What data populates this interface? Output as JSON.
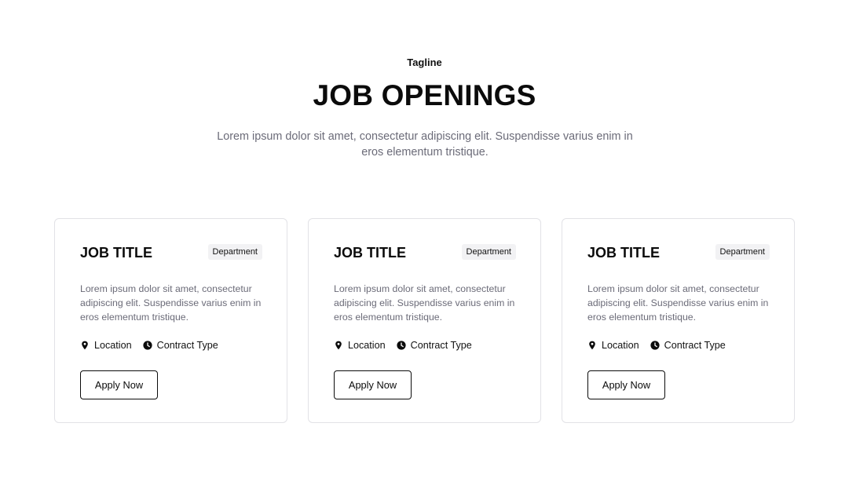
{
  "header": {
    "tagline": "Tagline",
    "title": "JOB OPENINGS",
    "description": "Lorem ipsum dolor sit amet, consectetur adipiscing elit. Suspendisse varius enim in eros elementum tristique."
  },
  "jobs": [
    {
      "title": "JOB TITLE",
      "department": "Department",
      "description": "Lorem ipsum dolor sit amet, consectetur adipiscing elit. Suspendisse varius enim in eros elementum tristique.",
      "location": "Location",
      "contract_type": "Contract Type",
      "location_icon": "map-pin-icon",
      "contract_icon": "clock-icon",
      "apply_label": "Apply Now"
    },
    {
      "title": "JOB TITLE",
      "department": "Department",
      "description": "Lorem ipsum dolor sit amet, consectetur adipiscing elit. Suspendisse varius enim in eros elementum tristique.",
      "location": "Location",
      "contract_type": "Contract Type",
      "location_icon": "map-pin-icon",
      "contract_icon": "clock-icon",
      "apply_label": "Apply Now"
    },
    {
      "title": "JOB TITLE",
      "department": "Department",
      "description": "Lorem ipsum dolor sit amet, consectetur adipiscing elit. Suspendisse varius enim in eros elementum tristique.",
      "location": "Location",
      "contract_type": "Contract Type",
      "location_icon": "map-pin-icon",
      "contract_icon": "clock-icon",
      "apply_label": "Apply Now"
    }
  ],
  "colors": {
    "text": "#0b0b0b",
    "muted": "#6b6b78",
    "card_border": "#e2e2e6",
    "badge_bg": "#f2f2f4"
  }
}
